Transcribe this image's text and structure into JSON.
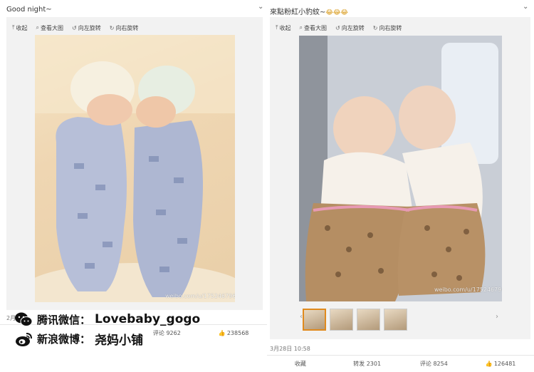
{
  "left_post": {
    "caption": "Good night~",
    "toolbar": [
      "收起",
      "查看大图",
      "向左旋转",
      "向右旋转"
    ],
    "watermark": "weibo.com/u/1752467960",
    "date": "2月",
    "actions": {
      "comment": "评论 9262",
      "like": "238568"
    }
  },
  "right_post": {
    "caption": "來點粉紅小豹紋~",
    "caption_emoji": "😂😂😂",
    "toolbar": [
      "收起",
      "查看大图",
      "向左旋转",
      "向右旋转"
    ],
    "watermark": "weibo.com/u/1752467960",
    "date": "3月28日 10:58",
    "actions": {
      "collect": "收藏",
      "repost": "转发 2301",
      "comment": "评论 8254",
      "like": "126481"
    }
  },
  "overlay": {
    "wechat_label": "腾讯微信：",
    "wechat_value": "Lovebaby_gogo",
    "weibo_label": "新浪微博：",
    "weibo_value": "尧妈小铺"
  },
  "icons": {
    "chevron": "chevron-down-icon",
    "wechat": "wechat-logo-icon",
    "weibo": "weibo-logo-icon"
  }
}
